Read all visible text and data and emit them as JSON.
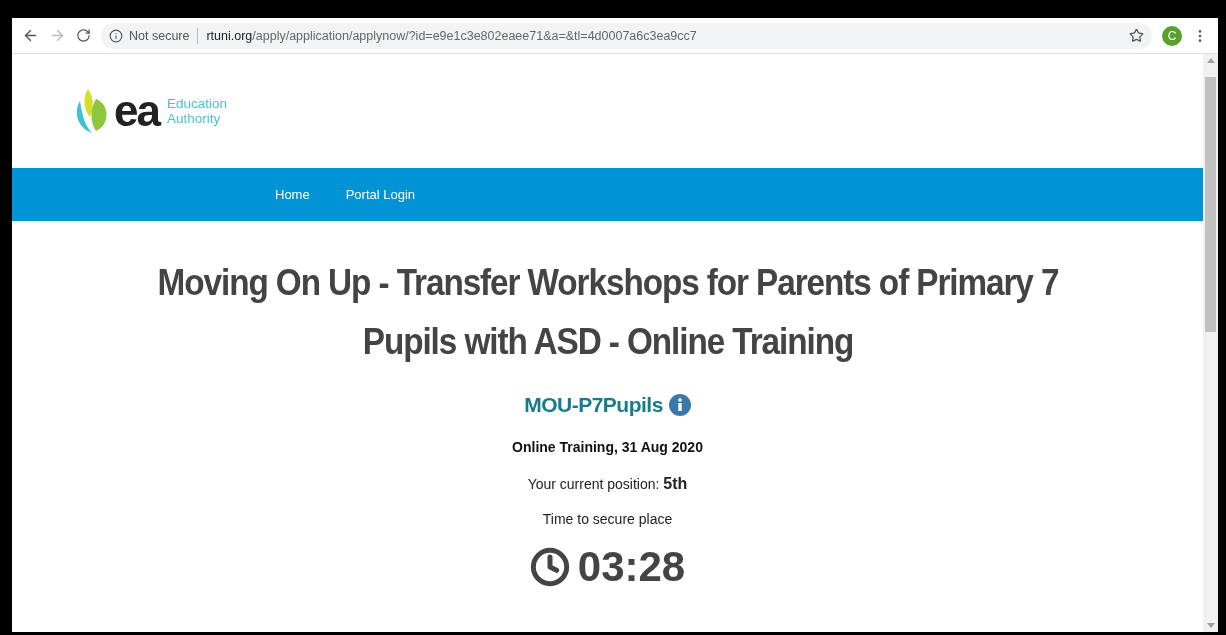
{
  "browser": {
    "security": "Not secure",
    "url_host": "rtuni.org",
    "url_path": "/apply/application/applynow/?id=e9e1c3e802eaee71&a=&tl=4d0007a6c3ea9cc7",
    "profile_initial": "C"
  },
  "logo": {
    "mark": "ea",
    "name_line_1": "Education",
    "name_line_2": "Authority"
  },
  "nav": [
    {
      "label": "Home"
    },
    {
      "label": "Portal Login"
    }
  ],
  "title": "Moving On Up - Transfer Workshops for Parents of Primary 7 Pupils with ASD - Online Training",
  "course_code": "MOU-P7Pupils",
  "session": "Online Training, 31 Aug 2020",
  "position": "Your current position: **5th**",
  "timer_label": "Time to secure place",
  "timer": "03:28"
}
